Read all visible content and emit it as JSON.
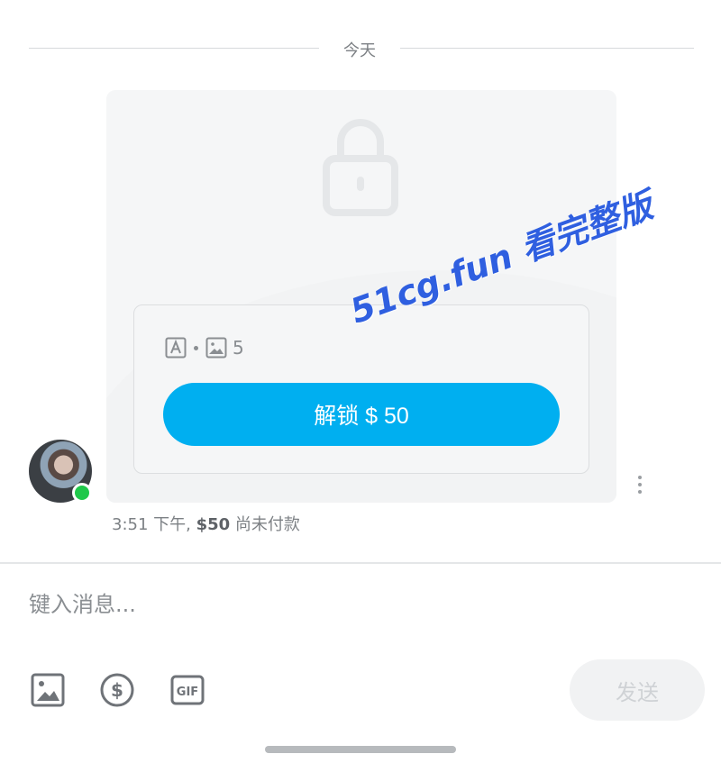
{
  "date_separator": "今天",
  "message": {
    "attachment_count": "5",
    "unlock_label": "解锁 $ 50",
    "time": "3:51 下午,",
    "price": "$50",
    "status": "尚未付款",
    "icons": [
      "lock-icon",
      "text-icon",
      "image-icon",
      "more-vertical-icon"
    ]
  },
  "watermark": "51cg.fun 看完整版",
  "composer": {
    "placeholder": "键入消息...",
    "send_label": "发送",
    "tools": [
      "image-icon",
      "dollar-icon",
      "gif-icon"
    ]
  },
  "colors": {
    "accent": "#00aff0",
    "online": "#1fc84a",
    "watermark": "#2f5fe0"
  }
}
